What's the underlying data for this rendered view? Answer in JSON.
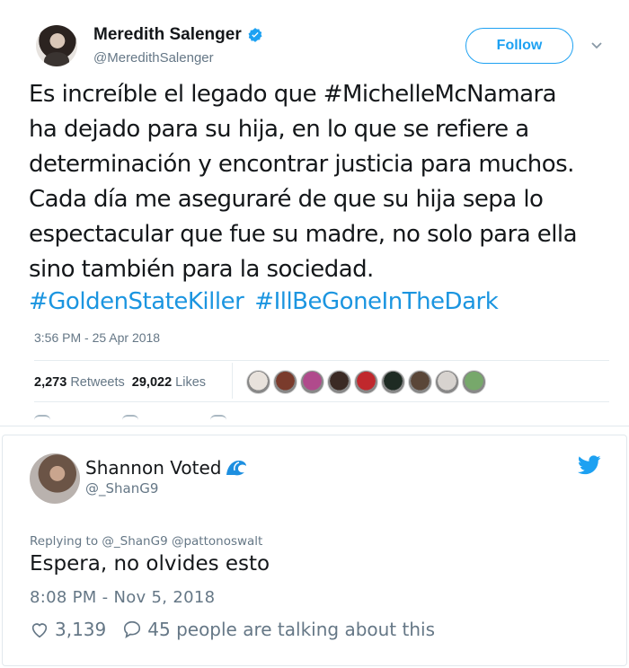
{
  "tweet": {
    "author_name": "Meredith Salenger",
    "author_handle": "@MeredithSalenger",
    "follow_label": "Follow",
    "lines": [
      "Es increíble el legado que #MichelleMcNamara",
      "ha dejado para su hija, en lo que se refiere a",
      "determinación y encontrar justicia para muchos.",
      "Cada día me aseguraré de que su hija sepa lo",
      "espectacular que fue su madre, no solo para ella",
      "sino también para la sociedad."
    ],
    "hashtags": [
      "#GoldenStateKiller",
      "#IllBeGoneInTheDark"
    ],
    "timestamp": "3:56 PM - 25 Apr 2018",
    "retweets_count": "2,273",
    "retweets_label": "Retweets",
    "likes_count": "29,022",
    "likes_label": "Likes",
    "liker_face_colors": [
      "#e8e2dc",
      "#7a3b2c",
      "#b04a8c",
      "#3b2a24",
      "#c0282d",
      "#1e2b23",
      "#5a4638",
      "#d7d3cf",
      "#77a86b"
    ]
  },
  "reply": {
    "author_name": "Shannon Voted",
    "author_handle": "@_ShanG9",
    "replying_to": "Replying to @_ShanG9 @pattonoswalt",
    "text": "Espera, no olvides esto",
    "timestamp": "8:08 PM - Nov 5, 2018",
    "likes": "3,139",
    "talking": "45 people are talking about this"
  },
  "colors": {
    "accent": "#1da1f2",
    "link": "#1b95e0",
    "muted": "#657786"
  }
}
